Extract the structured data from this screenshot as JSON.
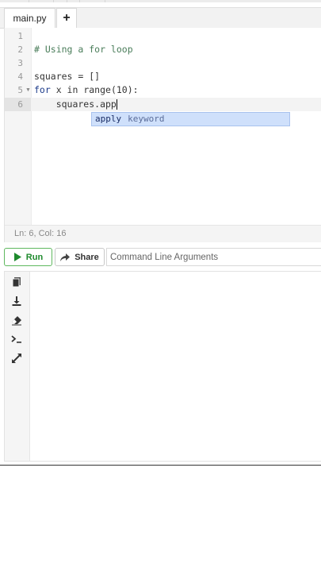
{
  "tabs": [
    {
      "label": "main.py"
    }
  ],
  "tab_add_label": "+",
  "editor": {
    "line_numbers": [
      "1",
      "2",
      "3",
      "4",
      "5",
      "6"
    ],
    "lines": {
      "l2": "# Using a for loop",
      "l4": "squares = []",
      "l5_kw": "for",
      "l5_rest": " x in range(10):",
      "l6": "    squares.app"
    },
    "autocomplete": {
      "word": "apply",
      "kind": "keyword"
    },
    "status": "Ln: 6,  Col: 16"
  },
  "toolbar": {
    "run_label": "Run",
    "share_label": "Share",
    "args_placeholder": "Command Line Arguments"
  },
  "colors": {
    "run": "#1e8a2d",
    "autocomplete_bg": "#cfe0fb"
  },
  "output_icons": [
    "copy-icon",
    "download-icon",
    "eraser-icon",
    "terminal-icon",
    "expand-icon"
  ]
}
